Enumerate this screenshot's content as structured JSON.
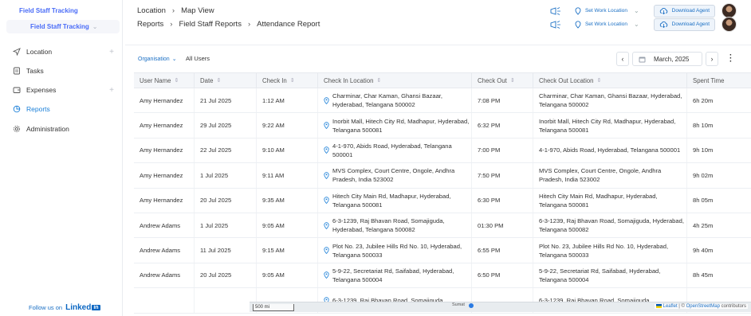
{
  "sidebar": {
    "crumb_top": "Field Staff Tracking",
    "crumb_sub": "Field Staff Tracking",
    "items": [
      {
        "label": "Location",
        "has_plus": true
      },
      {
        "label": "Tasks",
        "has_plus": false
      },
      {
        "label": "Expenses",
        "has_plus": true
      },
      {
        "label": "Reports",
        "has_plus": false,
        "active": true
      },
      {
        "label": "Administration",
        "has_plus": false
      }
    ],
    "follow_text": "Follow us on",
    "linkedin": "Linked",
    "linkedin_in": "in"
  },
  "header": {
    "row1": {
      "a": "Location",
      "b": "Map View"
    },
    "row2": {
      "a": "Reports",
      "b": "Field Staff Reports",
      "c": "Attendance Report"
    },
    "set_work_location": "Set Work Location",
    "download_agent": "Download Agent"
  },
  "toolbar": {
    "organisation": "Organisation",
    "all_users": "All Users",
    "prev": "‹",
    "next": "›",
    "month": "March, 2025"
  },
  "table": {
    "columns": [
      "User Name",
      "Date",
      "Check In",
      "Check In Location",
      "Check Out",
      "Check Out Location",
      "Spent Time"
    ],
    "rows": [
      {
        "user": "Amy Hernandez",
        "date": "21 Jul 2025",
        "in": "1:12 AM",
        "in_loc": "Charminar, Char Kaman, Ghansi Bazaar, Hyderabad, Telangana 500002",
        "out": "7:08 PM",
        "out_loc": "Charminar, Char Kaman, Ghansi Bazaar, Hyderabad, Telangana 500002",
        "spent": "6h 20m"
      },
      {
        "user": "Amy Hernandez",
        "date": "29 Jul 2025",
        "in": "9:22 AM",
        "in_loc": "Inorbit Mall, Hitech City Rd, Madhapur, Hyderabad, Telangana 500081",
        "out": "6:32 PM",
        "out_loc": "Inorbit Mall, Hitech City Rd, Madhapur, Hyderabad, Telangana 500081",
        "spent": "8h 10m"
      },
      {
        "user": "Amy Hernandez",
        "date": "22 Jul 2025",
        "in": "9:10 AM",
        "in_loc": "4-1-970, Abids Road, Hyderabad, Telangana 500001",
        "out": "7:00 PM",
        "out_loc": "4-1-970, Abids Road, Hyderabad, Telangana 500001",
        "spent": "9h 10m"
      },
      {
        "user": "Amy Hernandez",
        "date": "1 Jul 2025",
        "in": "9:11 AM",
        "in_loc": "MVS Complex, Court Centre, Ongole, Andhra Pradesh, India 523002",
        "out": "7:50 PM",
        "out_loc": "MVS Complex, Court Centre, Ongole, Andhra Pradesh, India 523002",
        "spent": "9h 02m"
      },
      {
        "user": "Amy Hernandez",
        "date": "20 Jul 2025",
        "in": "9:35 AM",
        "in_loc": "Hitech City Main Rd, Madhapur, Hyderabad, Telangana 500081",
        "out": "6:30 PM",
        "out_loc": "Hitech City Main Rd, Madhapur, Hyderabad, Telangana 500081",
        "spent": "8h 05m"
      },
      {
        "user": "Andrew Adams",
        "date": "1 Jul 2025",
        "in": "9:05 AM",
        "in_loc": "6-3-1239, Raj Bhavan Road, Somajiguda, Hyderabad, Telangana 500082",
        "out": "01:30 PM",
        "out_loc": "6-3-1239, Raj Bhavan Road, Somajiguda, Hyderabad, Telangana 500082",
        "spent": "4h 25m"
      },
      {
        "user": "Andrew Adams",
        "date": "11 Jul 2025",
        "in": "9:15 AM",
        "in_loc": "Plot No. 23, Jubilee Hills Rd No. 10, Hyderabad, Telangana 500033",
        "out": "6:55 PM",
        "out_loc": "Plot No. 23, Jubilee Hills Rd No. 10, Hyderabad, Telangana 500033",
        "spent": "9h 40m"
      },
      {
        "user": "Andrew Adams",
        "date": "20 Jul 2025",
        "in": "9:05 AM",
        "in_loc": "5-9-22, Secretariat Rd, Saifabad, Hyderabad, Telangana 500004",
        "out": "6:50 PM",
        "out_loc": "5-9-22, Secretariat Rd, Saifabad, Hyderabad, Telangana 500004",
        "spent": "8h 45m"
      },
      {
        "user": "",
        "date": "",
        "in": "",
        "in_loc": "6-3-1239, Raj Bhavan Road, Somajiguda",
        "out": "",
        "out_loc": "6-3-1239, Raj Bhavan Road, Somajiguda",
        "spent": ""
      }
    ]
  },
  "map": {
    "scale": "500 mi",
    "place": "Sumat",
    "leaflet": "Leaflet",
    "osm": "OpenStreetMap",
    "contributors": "contributors"
  },
  "colors": {
    "accent": "#1a6fc4",
    "active": "#1a7fd8"
  }
}
